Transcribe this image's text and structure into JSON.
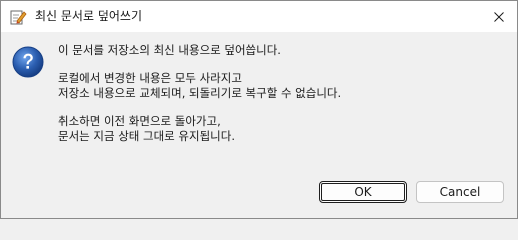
{
  "window": {
    "title": "최신 문서로 덮어쓰기",
    "title_icon": "edit-document-icon",
    "close_icon": "close-icon"
  },
  "dialog": {
    "icon": "question-icon",
    "lines": [
      "이 문서를 저장소의 최신 내용으로 덮어씁니다.",
      "",
      "로컬에서 변경한 내용은 모두 사라지고",
      "저장소 내용으로 교체되며, 되돌리기로 복구할 수 없습니다.",
      "",
      "취소하면 이전 화면으로 돌아가고,",
      "문서는 지금 상태 그대로 유지됩니다."
    ]
  },
  "buttons": {
    "ok_label": "OK",
    "cancel_label": "Cancel"
  },
  "colors": {
    "question_icon_blue": "#2b5eb0",
    "background": "#f0f0f0",
    "titlebar": "#ffffff"
  }
}
